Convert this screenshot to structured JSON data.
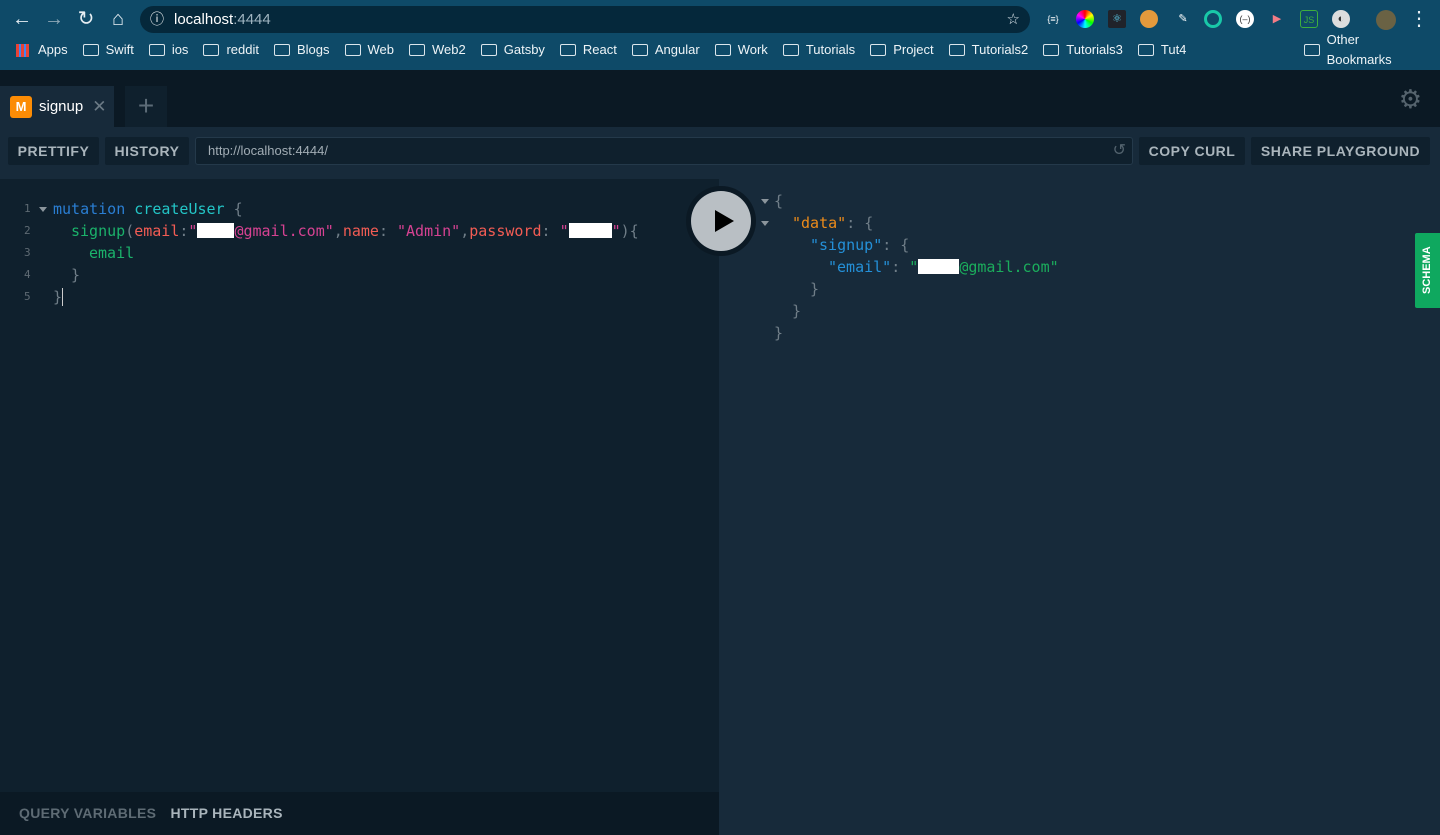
{
  "browser": {
    "url_host": "localhost",
    "url_port": ":4444",
    "extensions": [
      "json-formatter",
      "color-picker",
      "react-devtools",
      "cookie-editor",
      "eyedropper",
      "orbit",
      "graphql",
      "video-extension",
      "nodejs",
      "dark-reader"
    ],
    "bookmarks": [
      "Apps",
      "Swift",
      "ios",
      "reddit",
      "Blogs",
      "Web",
      "Web2",
      "Gatsby",
      "React",
      "Angular",
      "Work",
      "Tutorials",
      "Project",
      "Tutorials2",
      "Tutorials3",
      "Tut4"
    ],
    "other_bookmarks": "Other Bookmarks"
  },
  "tabs": [
    {
      "badge": "M",
      "label": "signup"
    }
  ],
  "toolbar": {
    "prettify": "PRETTIFY",
    "history": "HISTORY",
    "endpoint": "http://localhost:4444/",
    "copy_curl": "COPY CURL",
    "share": "SHARE PLAYGROUND"
  },
  "editor": {
    "line_numbers": [
      "1",
      "2",
      "3",
      "4",
      "5"
    ],
    "kw": "mutation",
    "op": "createUser",
    "field": "signup",
    "arg_email": "email",
    "arg_name": "name",
    "arg_password": "password",
    "email_suffix": "@gmail.com",
    "name_value": "\"Admin\"",
    "sub_field": "email"
  },
  "result": {
    "data_key": "\"data\"",
    "signup_key": "\"signup\"",
    "email_key": "\"email\"",
    "email_suffix": "@gmail.com\""
  },
  "schema_label": "SCHEMA",
  "bottom": {
    "query_variables": "QUERY VARIABLES",
    "http_headers": "HTTP HEADERS"
  },
  "colors": {
    "accent_orange": "#fc8c05",
    "schema_green": "#0fa85f"
  }
}
